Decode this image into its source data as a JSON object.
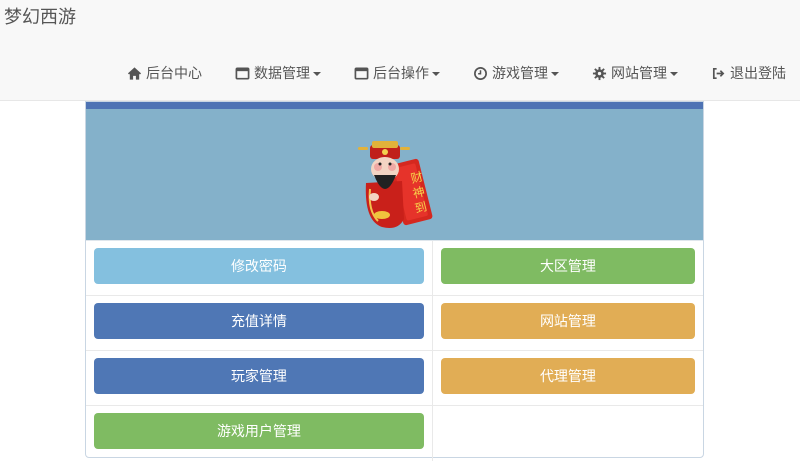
{
  "brand": {
    "title": "梦幻西游"
  },
  "nav": {
    "items": [
      {
        "label": "后台中心",
        "icon": "home-icon",
        "dropdown": false
      },
      {
        "label": "数据管理",
        "icon": "window-icon",
        "dropdown": true
      },
      {
        "label": "后台操作",
        "icon": "window-icon",
        "dropdown": true
      },
      {
        "label": "游戏管理",
        "icon": "clock-icon",
        "dropdown": true
      },
      {
        "label": "网站管理",
        "icon": "gear-icon",
        "dropdown": true
      },
      {
        "label": "退出登陆",
        "icon": "logout-icon",
        "dropdown": false
      }
    ]
  },
  "panel": {
    "mascot_text": "财神到",
    "buttons": [
      {
        "label": "修改密码",
        "style": "info"
      },
      {
        "label": "大区管理",
        "style": "success"
      },
      {
        "label": "充值详情",
        "style": "primary"
      },
      {
        "label": "网站管理",
        "style": "warning"
      },
      {
        "label": "玩家管理",
        "style": "primary"
      },
      {
        "label": "代理管理",
        "style": "warning"
      },
      {
        "label": "游戏用户管理",
        "style": "success"
      }
    ]
  },
  "colors": {
    "strip": "#4e73b4",
    "banner": "#84b1ca",
    "info": "#84c0df",
    "primary": "#4f77b5",
    "success": "#7fbb62",
    "warning": "#e1ad55"
  }
}
